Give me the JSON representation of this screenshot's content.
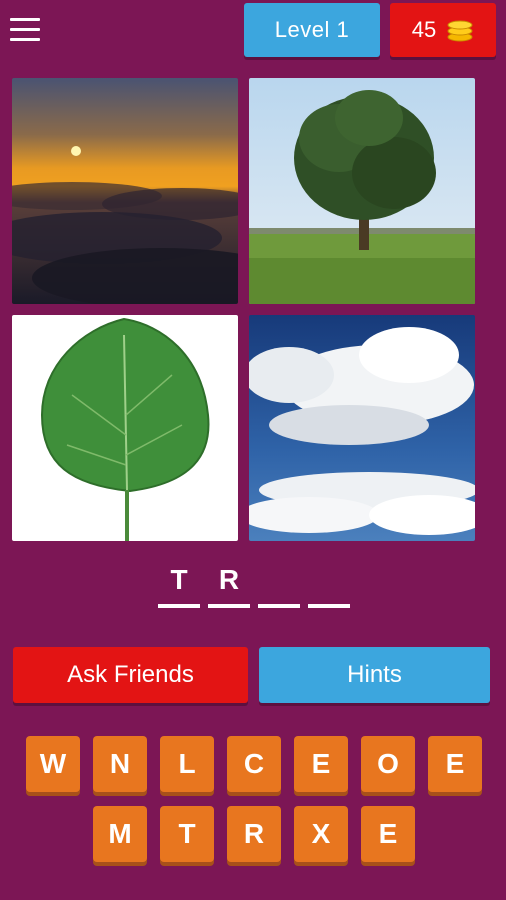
{
  "header": {
    "menu_icon": "hamburger-menu-icon",
    "level_label": "Level 1",
    "coins": "45",
    "coin_icon": "coin-stack-icon"
  },
  "images": [
    {
      "subject": "sunset-above-clouds"
    },
    {
      "subject": "tree-in-field"
    },
    {
      "subject": "green-leaf"
    },
    {
      "subject": "clouds-in-sky"
    }
  ],
  "answer_slots": [
    "T",
    "R",
    "",
    ""
  ],
  "buttons": {
    "ask_friends": "Ask Friends",
    "hints": "Hints"
  },
  "keyboard": {
    "row1": [
      "W",
      "N",
      "L",
      "C",
      "E",
      "O",
      "E"
    ],
    "row2": [
      "M",
      "T",
      "R",
      "X",
      "E"
    ]
  },
  "colors": {
    "background": "#7c1655",
    "blue": "#3ca6de",
    "red": "#e31414",
    "orange_key": "#e8761f"
  }
}
